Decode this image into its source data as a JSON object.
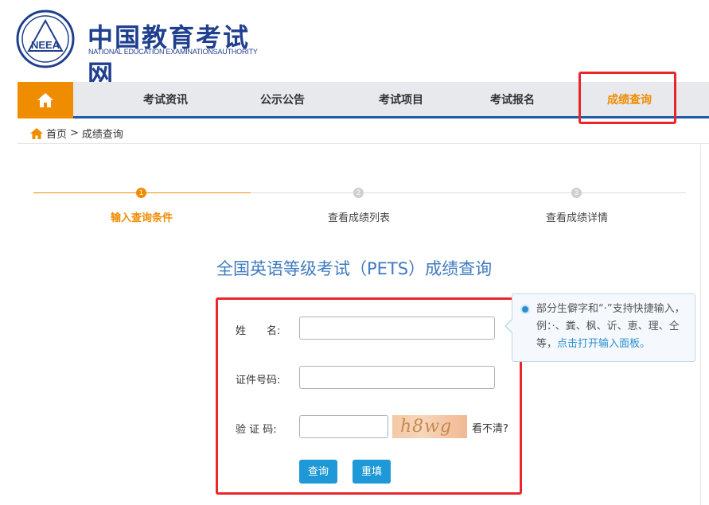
{
  "header": {
    "logo_text": "NEEA",
    "site_title": "中国教育考试网",
    "site_subtitle": "NATIONAL EDUCATION EXAMINATIONSAUTHORITY"
  },
  "nav": {
    "items": [
      {
        "label": "考试资讯"
      },
      {
        "label": "公示公告"
      },
      {
        "label": "考试项目"
      },
      {
        "label": "考试报名"
      },
      {
        "label": "成绩查询"
      }
    ],
    "active_index": 4
  },
  "breadcrumb": {
    "home": "首页",
    "separator": ">",
    "current": "成绩查询"
  },
  "steps": [
    {
      "number": "1",
      "label": "输入查询条件"
    },
    {
      "number": "2",
      "label": "查看成绩列表"
    },
    {
      "number": "3",
      "label": "查看成绩详情"
    }
  ],
  "form": {
    "title": "全国英语等级考试（PETS）成绩查询",
    "name_label": "姓　　名:",
    "id_label": "证件号码:",
    "captcha_label": "验 证 码:",
    "name_value": "",
    "id_value": "",
    "captcha_value": "",
    "captcha_text": "h8wg",
    "refresh_label": "看不清?",
    "submit_label": "查询",
    "reset_label": "重填"
  },
  "tip": {
    "text": "部分生僻字和“·”支持快捷输入，例：·、粪、枫、䜣、恵、理、仝等，",
    "link": "点击打开输入面板。"
  },
  "colors": {
    "accent": "#f08c00",
    "brand": "#1f3f8f",
    "nav_border": "#1f5aa6",
    "highlight": "#e8262c",
    "button": "#1e98d6"
  }
}
